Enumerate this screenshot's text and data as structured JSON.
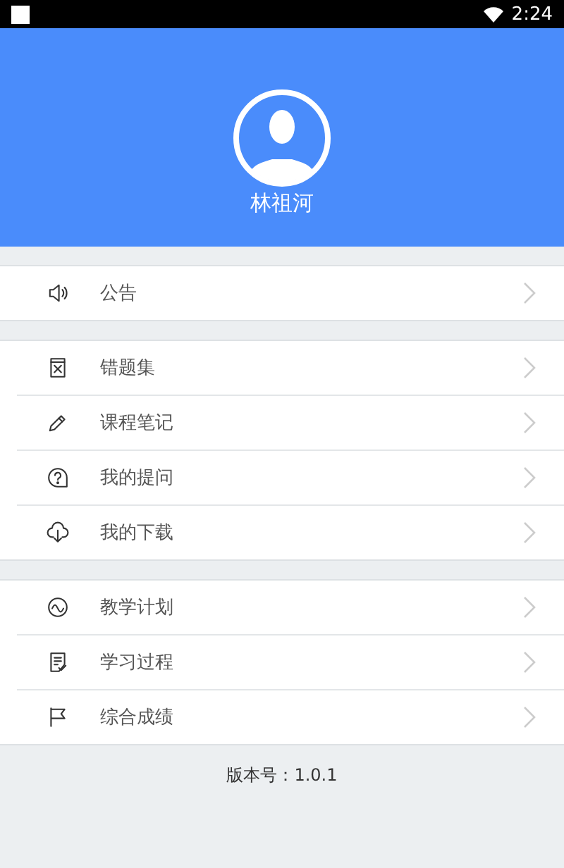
{
  "status_bar": {
    "time": "2:24"
  },
  "profile": {
    "name": "林祖河"
  },
  "menu_groups": [
    [
      {
        "label": "公告"
      }
    ],
    [
      {
        "label": "错题集"
      },
      {
        "label": "课程笔记"
      },
      {
        "label": "我的提问"
      },
      {
        "label": "我的下载"
      }
    ],
    [
      {
        "label": "教学计划"
      },
      {
        "label": "学习过程"
      },
      {
        "label": "综合成绩"
      }
    ]
  ],
  "footer": {
    "version": "版本号：1.0.1"
  }
}
